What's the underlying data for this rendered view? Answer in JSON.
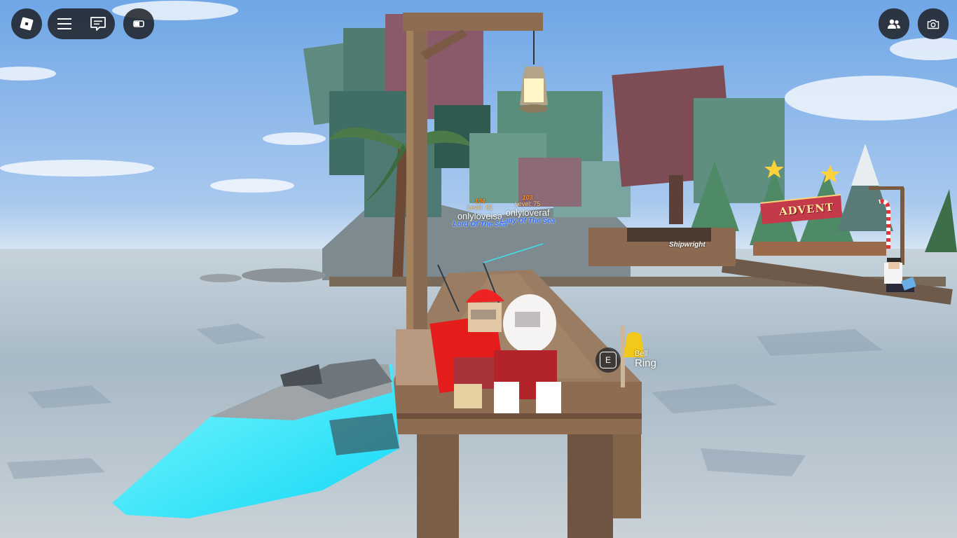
{
  "hud": {
    "roblox_menu_icon": "roblox-logo-icon",
    "menu_icon": "hamburger-menu-icon",
    "chat_icon": "chat-bubble-icon",
    "backpack_icon": "backpack-toggle-icon",
    "players_icon": "people-icon",
    "capture_icon": "camera-icon"
  },
  "players": [
    {
      "level_number": "104",
      "level": "Level: 81",
      "name": "onlyloveisa",
      "title": "Lord Of The Sea"
    },
    {
      "level_number": "103",
      "level": "Level: 75",
      "name": "onlyloveraf",
      "title": "Lady Of The Sea"
    }
  ],
  "world_labels": {
    "shipwright": "Shipwright",
    "advent_banner": "ADVENT"
  },
  "interaction_prompt": {
    "key": "E",
    "object": "Bell",
    "action": "Ring"
  },
  "colors": {
    "hud_background": "#1e2024",
    "jetski_accent": "#18e8ff",
    "title_blue": "#2b6cff"
  }
}
